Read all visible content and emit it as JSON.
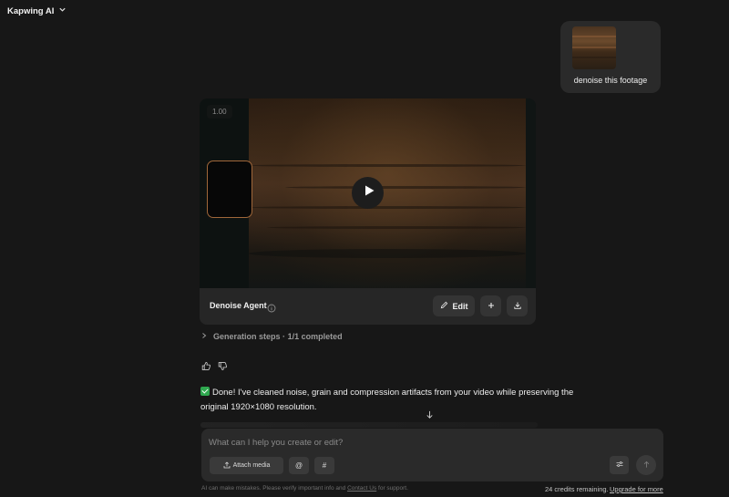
{
  "header": {
    "app_name": "Kapwing AI"
  },
  "user_message": {
    "text": "denoise this footage"
  },
  "video_card": {
    "zoom_label": "1.00",
    "agent_name": "Denoise Agent",
    "edit_label": "Edit"
  },
  "generation_steps": {
    "label": "Generation steps",
    "status": "1/1 completed",
    "separator": "·"
  },
  "reply": {
    "line1": "Done! I've cleaned noise, grain and compression artifacts from your video while preserving the",
    "line2": "original 1920×1080 resolution."
  },
  "composer": {
    "placeholder": "What can I help you create or edit?",
    "attach_label": "Attach media",
    "mention_label": "@",
    "hash_label": "#"
  },
  "footer": {
    "disclaimer_prefix": "AI can make mistakes. Please verify important info and",
    "contact_link": "Contact Us",
    "disclaimer_suffix": "for support.",
    "credits": "24 credits remaining.",
    "upgrade": "Upgrade for more"
  },
  "icons": {
    "app_switcher": "chevron-down-icon",
    "info": "info-icon",
    "edit": "pencil-icon",
    "add": "plus-icon",
    "download": "download-icon",
    "expand": "chevron-right-icon",
    "like": "thumbs-up-icon",
    "dislike": "thumbs-down-icon",
    "scroll": "arrow-down-icon",
    "attach": "upload-icon",
    "settings": "sliders-icon",
    "send": "arrow-up-icon",
    "play": "play-icon",
    "done": "check-box-icon"
  },
  "colors": {
    "background": "#171717",
    "card": "#262626",
    "check_green": "#2fa84f"
  }
}
